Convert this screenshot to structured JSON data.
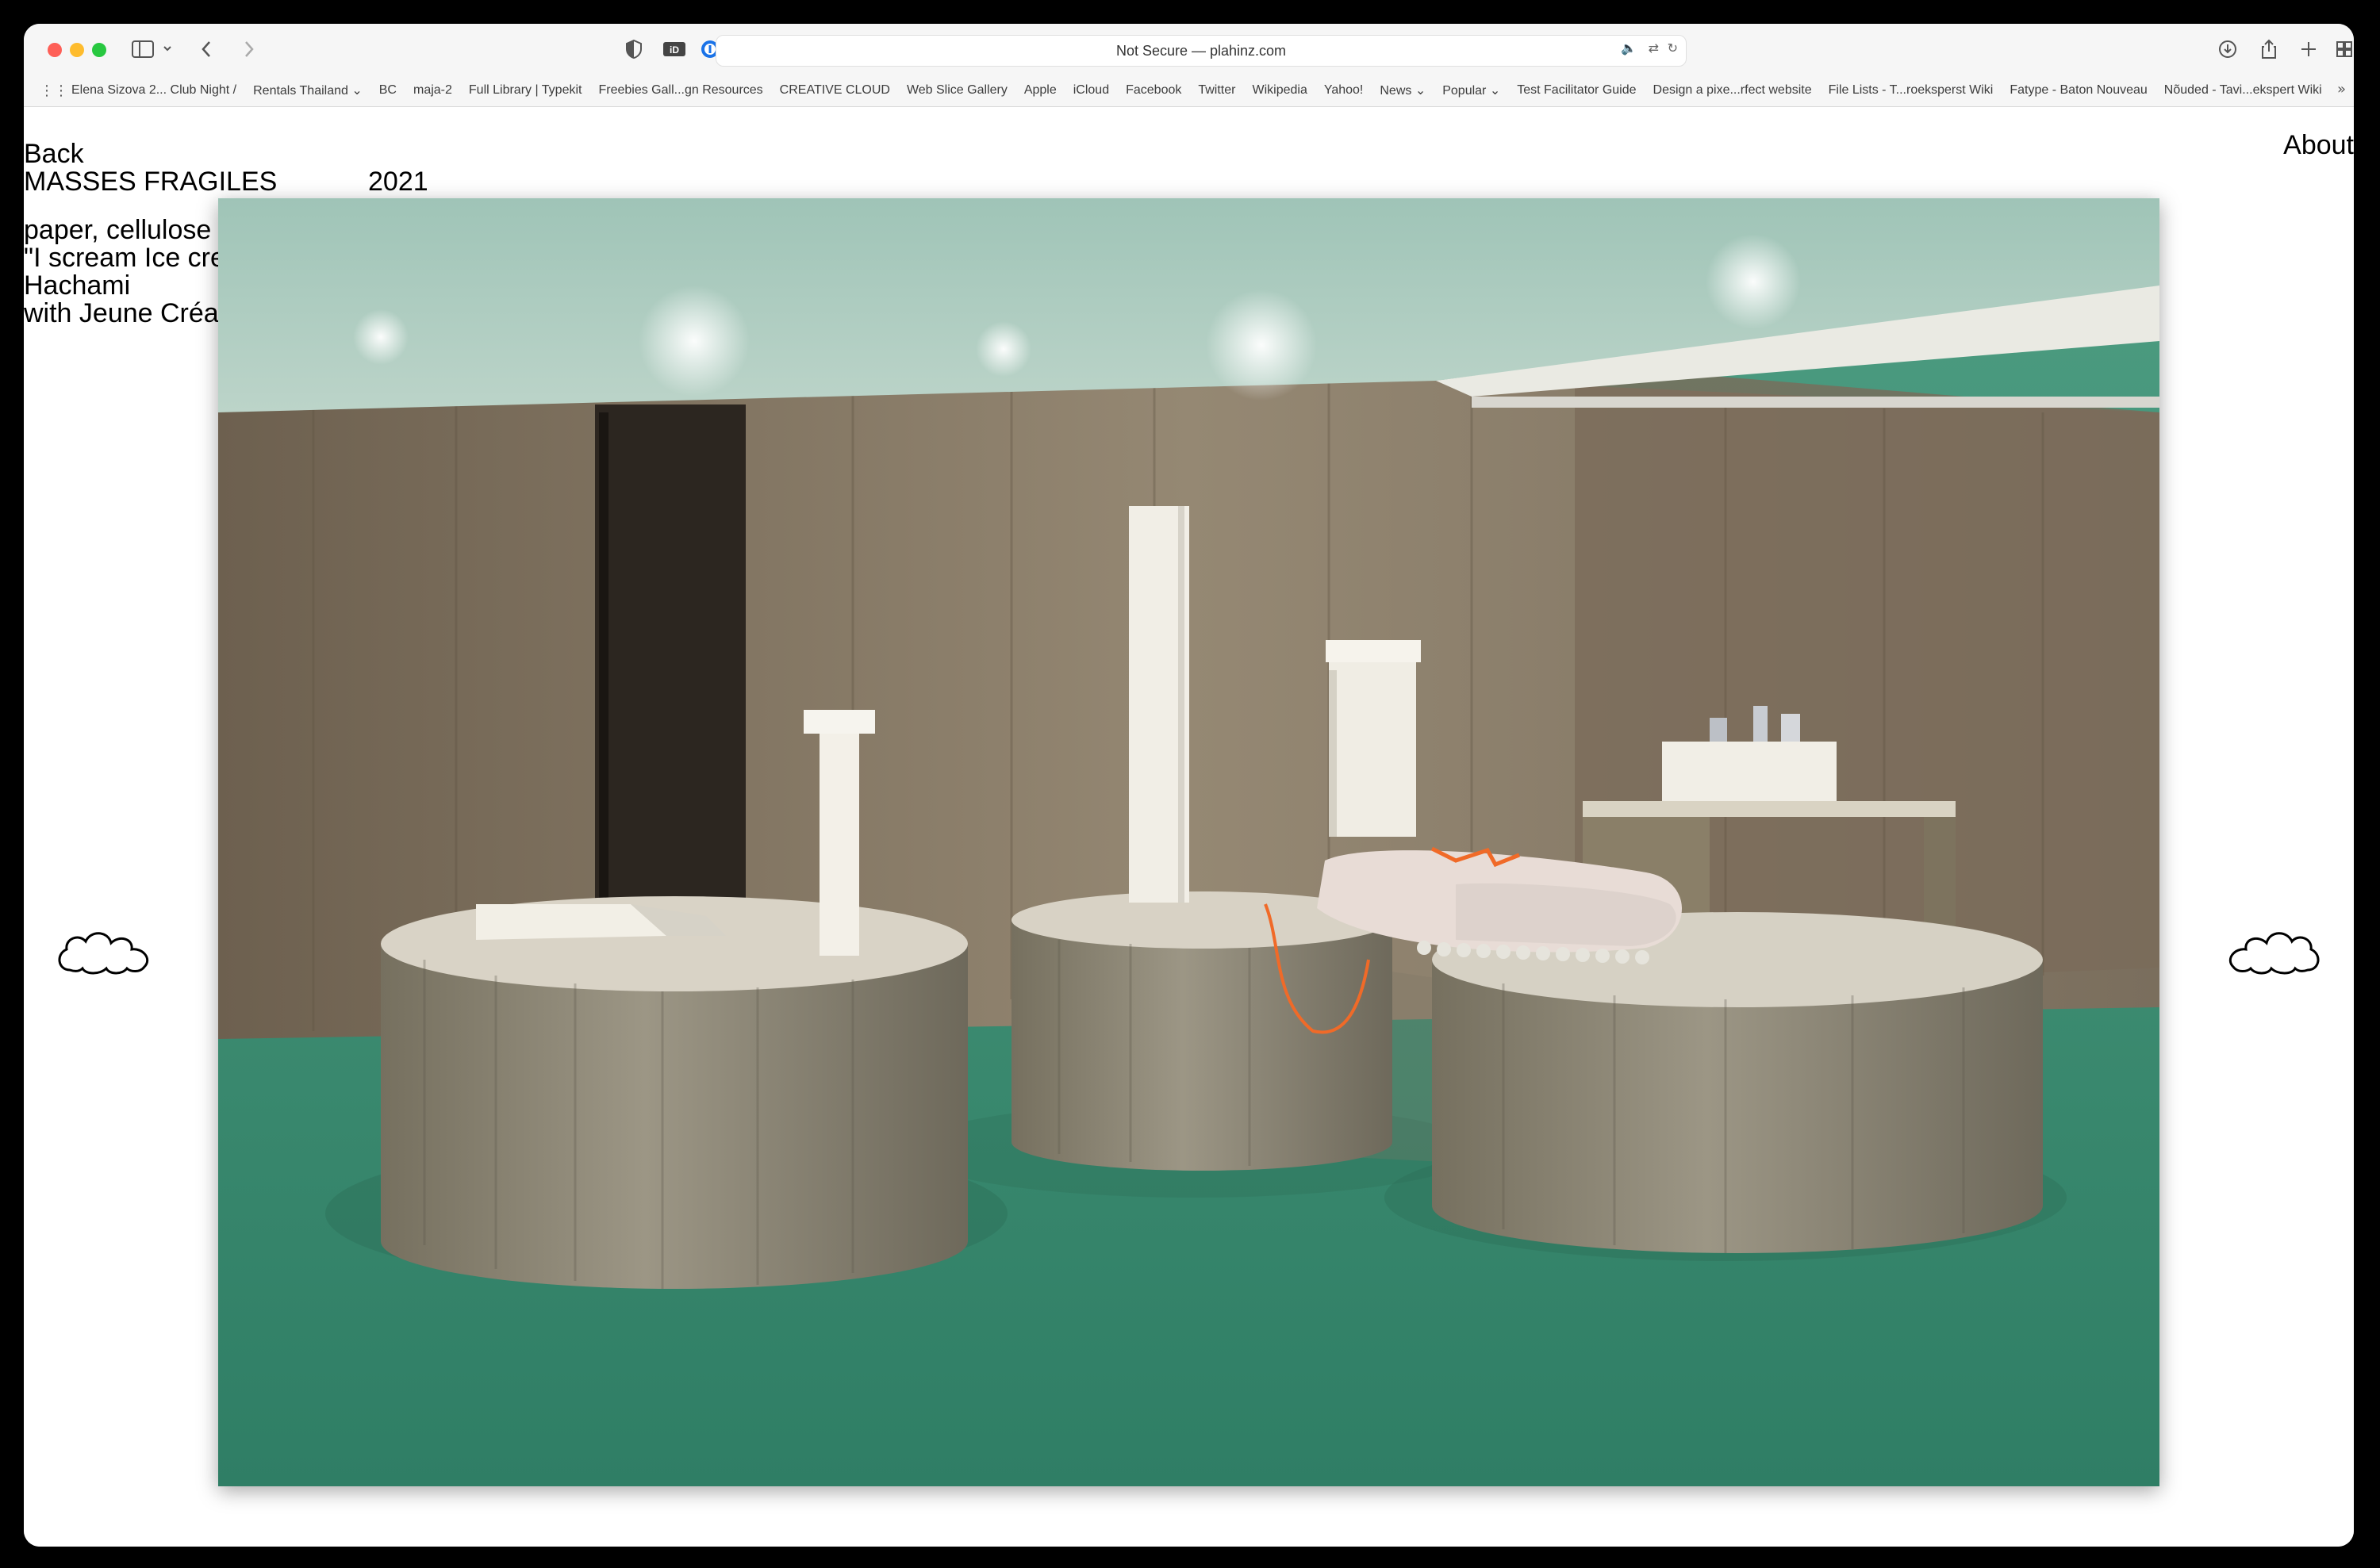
{
  "browser": {
    "address_text": "Not Secure — plahinz.com",
    "bookmarks": [
      "Elena Sizova 2... Club Night /",
      "Rentals Thailand ⌄",
      "BC",
      "maja-2",
      "Full Library | Typekit",
      "Freebies Gall...gn Resources",
      "CREATIVE CLOUD",
      "Web Slice Gallery",
      "Apple",
      "iCloud",
      "Facebook",
      "Twitter",
      "Wikipedia",
      "Yahoo!",
      "News ⌄",
      "Popular ⌄",
      "Test Facilitator Guide",
      "Design a pixe...rfect website",
      "File Lists - T...roeksperst Wiki",
      "Fatype - Baton Nouveau",
      "Nõuded - Tavi...ekspert Wiki"
    ]
  },
  "page": {
    "back_label": "Back",
    "about_label": "About",
    "title": "MASSES FRAGILES",
    "year": "2021",
    "description": [
      "paper, cellulose",
      "\"I scream Ice cre",
      "Hachami",
      "with Jeune Créa"
    ]
  },
  "photo": {
    "subject": "gallery installation: concrete cylinder pedestals with white sculptures on green floor"
  },
  "colors": {
    "floor": "#3f8f75",
    "ceiling": "#a6c7bb",
    "wall": "#8f8068",
    "concrete": "#8d8677"
  }
}
